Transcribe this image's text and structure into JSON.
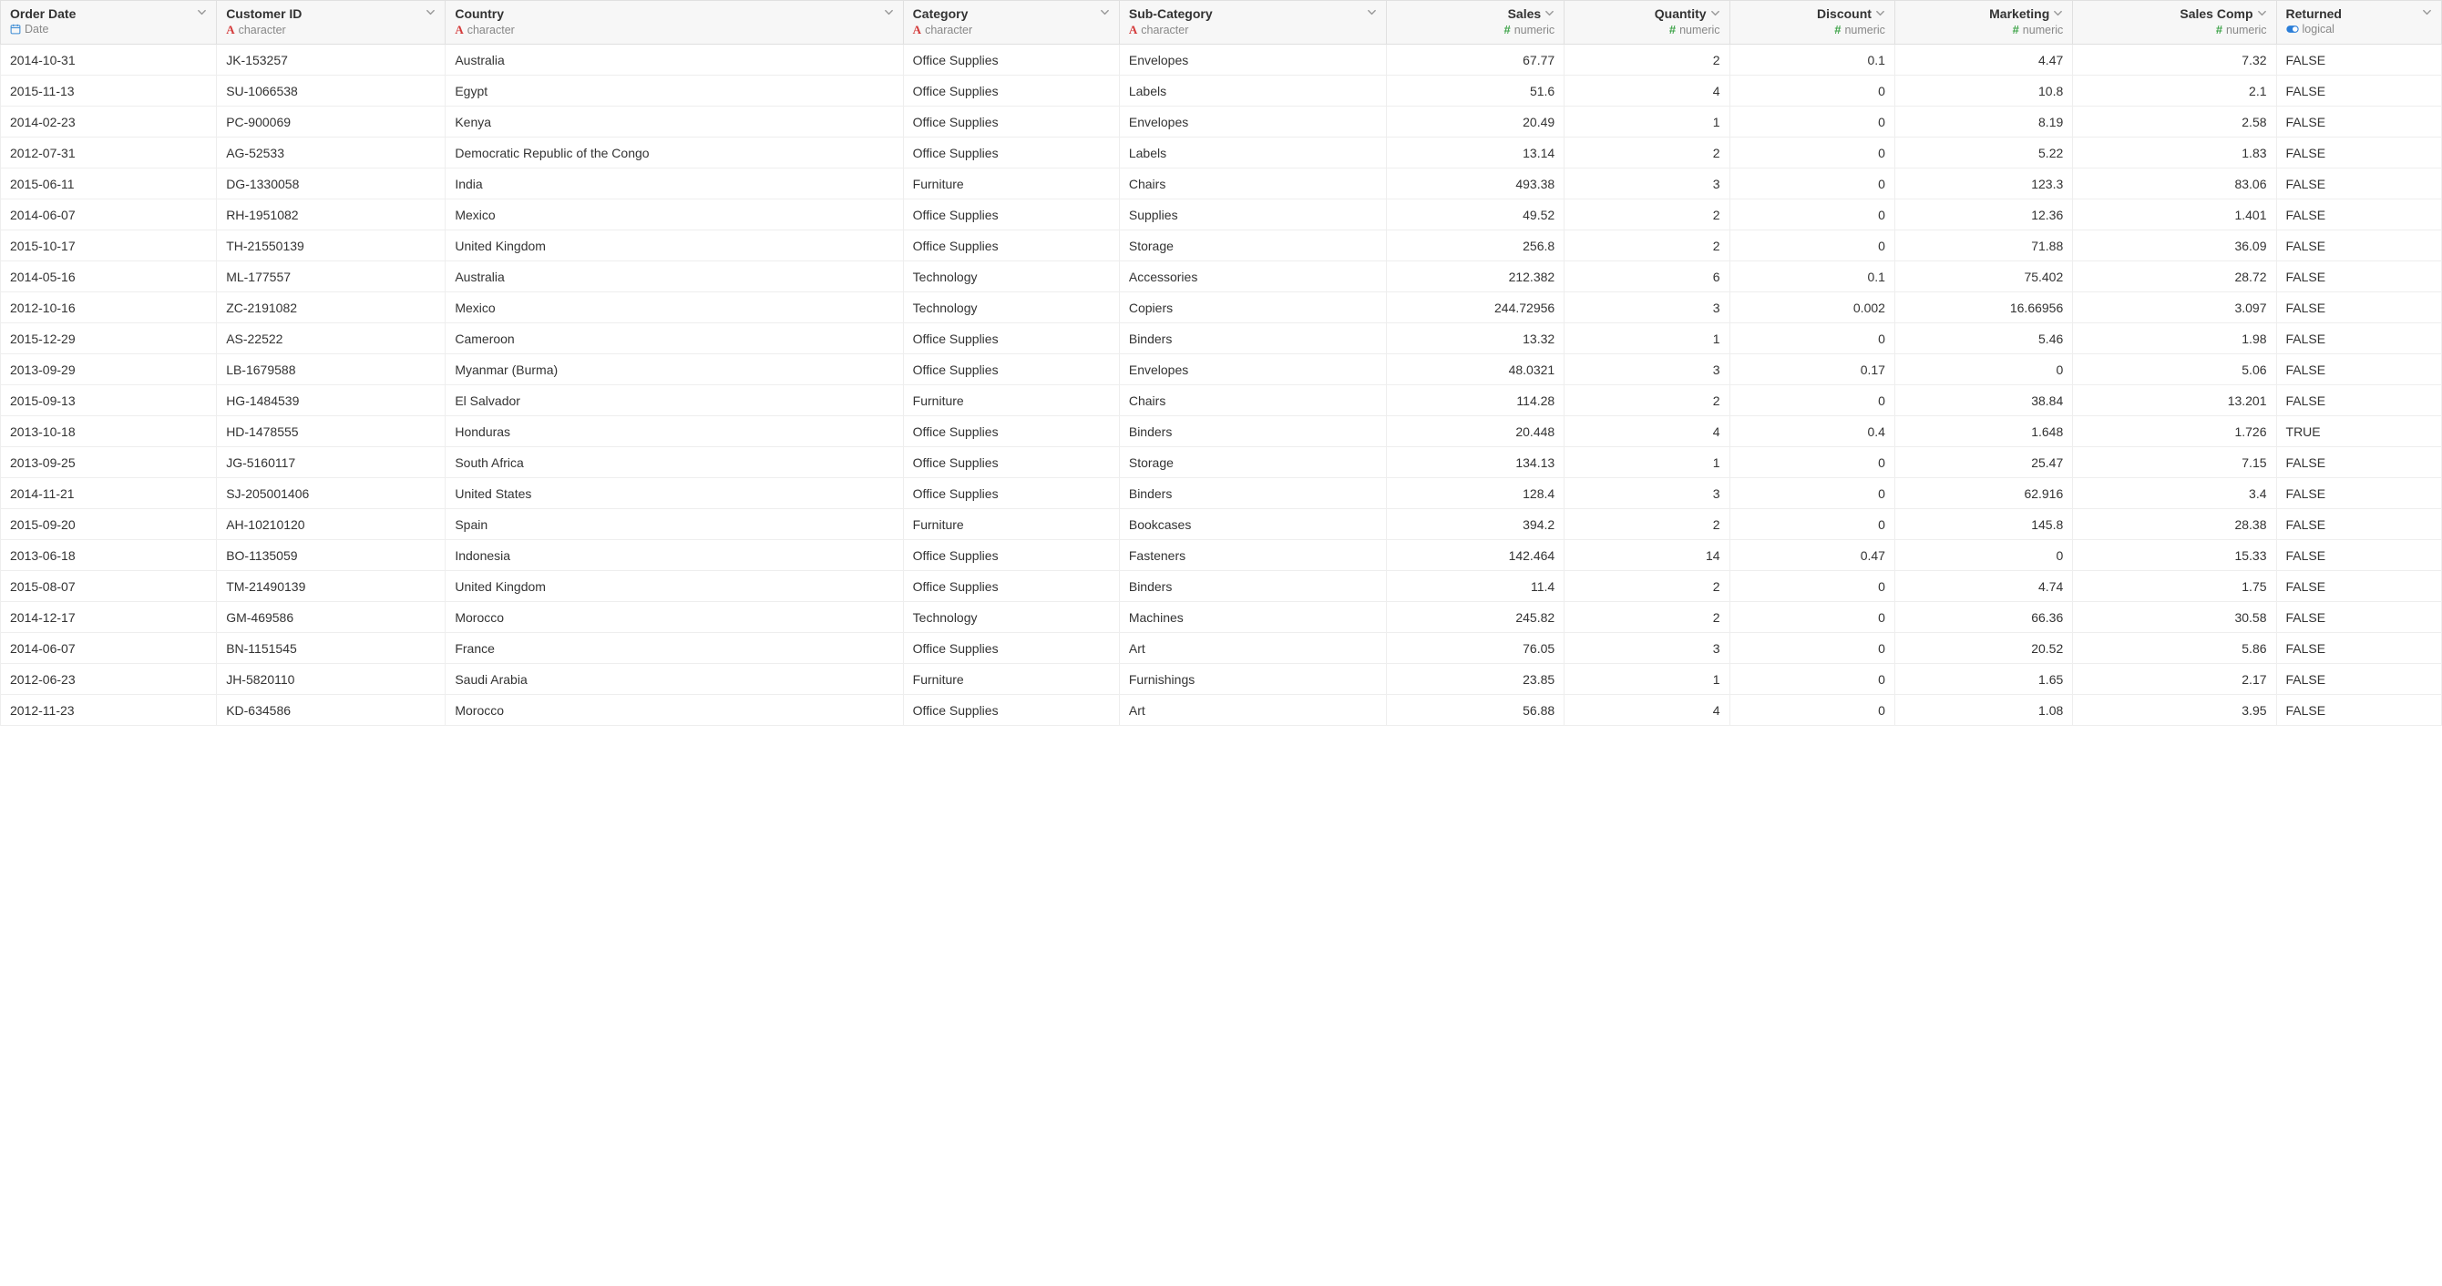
{
  "columns": [
    {
      "name": "Order Date",
      "type": "Date",
      "kind": "date",
      "align": "left",
      "width": "8.5%"
    },
    {
      "name": "Customer ID",
      "type": "character",
      "kind": "char",
      "align": "left",
      "width": "9%"
    },
    {
      "name": "Country",
      "type": "character",
      "kind": "char",
      "align": "left",
      "width": "18%"
    },
    {
      "name": "Category",
      "type": "character",
      "kind": "char",
      "align": "left",
      "width": "8.5%"
    },
    {
      "name": "Sub-Category",
      "type": "character",
      "kind": "char",
      "align": "left",
      "width": "10.5%"
    },
    {
      "name": "Sales",
      "type": "numeric",
      "kind": "numeric",
      "align": "right",
      "width": "7%"
    },
    {
      "name": "Quantity",
      "type": "numeric",
      "kind": "numeric",
      "align": "right",
      "width": "6.5%"
    },
    {
      "name": "Discount",
      "type": "numeric",
      "kind": "numeric",
      "align": "right",
      "width": "6.5%"
    },
    {
      "name": "Marketing",
      "type": "numeric",
      "kind": "numeric",
      "align": "right",
      "width": "7%"
    },
    {
      "name": "Sales Comp",
      "type": "numeric",
      "kind": "numeric",
      "align": "right",
      "width": "8%"
    },
    {
      "name": "Returned",
      "type": "logical",
      "kind": "logical",
      "align": "left",
      "width": "6.5%"
    }
  ],
  "rows": [
    [
      "2014-10-31",
      "JK-153257",
      "Australia",
      "Office Supplies",
      "Envelopes",
      "67.77",
      "2",
      "0.1",
      "4.47",
      "7.32",
      "FALSE"
    ],
    [
      "2015-11-13",
      "SU-1066538",
      "Egypt",
      "Office Supplies",
      "Labels",
      "51.6",
      "4",
      "0",
      "10.8",
      "2.1",
      "FALSE"
    ],
    [
      "2014-02-23",
      "PC-900069",
      "Kenya",
      "Office Supplies",
      "Envelopes",
      "20.49",
      "1",
      "0",
      "8.19",
      "2.58",
      "FALSE"
    ],
    [
      "2012-07-31",
      "AG-52533",
      "Democratic Republic of the Congo",
      "Office Supplies",
      "Labels",
      "13.14",
      "2",
      "0",
      "5.22",
      "1.83",
      "FALSE"
    ],
    [
      "2015-06-11",
      "DG-1330058",
      "India",
      "Furniture",
      "Chairs",
      "493.38",
      "3",
      "0",
      "123.3",
      "83.06",
      "FALSE"
    ],
    [
      "2014-06-07",
      "RH-1951082",
      "Mexico",
      "Office Supplies",
      "Supplies",
      "49.52",
      "2",
      "0",
      "12.36",
      "1.401",
      "FALSE"
    ],
    [
      "2015-10-17",
      "TH-21550139",
      "United Kingdom",
      "Office Supplies",
      "Storage",
      "256.8",
      "2",
      "0",
      "71.88",
      "36.09",
      "FALSE"
    ],
    [
      "2014-05-16",
      "ML-177557",
      "Australia",
      "Technology",
      "Accessories",
      "212.382",
      "6",
      "0.1",
      "75.402",
      "28.72",
      "FALSE"
    ],
    [
      "2012-10-16",
      "ZC-2191082",
      "Mexico",
      "Technology",
      "Copiers",
      "244.72956",
      "3",
      "0.002",
      "16.66956",
      "3.097",
      "FALSE"
    ],
    [
      "2015-12-29",
      "AS-22522",
      "Cameroon",
      "Office Supplies",
      "Binders",
      "13.32",
      "1",
      "0",
      "5.46",
      "1.98",
      "FALSE"
    ],
    [
      "2013-09-29",
      "LB-1679588",
      "Myanmar (Burma)",
      "Office Supplies",
      "Envelopes",
      "48.0321",
      "3",
      "0.17",
      "0",
      "5.06",
      "FALSE"
    ],
    [
      "2015-09-13",
      "HG-1484539",
      "El Salvador",
      "Furniture",
      "Chairs",
      "114.28",
      "2",
      "0",
      "38.84",
      "13.201",
      "FALSE"
    ],
    [
      "2013-10-18",
      "HD-1478555",
      "Honduras",
      "Office Supplies",
      "Binders",
      "20.448",
      "4",
      "0.4",
      "1.648",
      "1.726",
      "TRUE"
    ],
    [
      "2013-09-25",
      "JG-5160117",
      "South Africa",
      "Office Supplies",
      "Storage",
      "134.13",
      "1",
      "0",
      "25.47",
      "7.15",
      "FALSE"
    ],
    [
      "2014-11-21",
      "SJ-205001406",
      "United States",
      "Office Supplies",
      "Binders",
      "128.4",
      "3",
      "0",
      "62.916",
      "3.4",
      "FALSE"
    ],
    [
      "2015-09-20",
      "AH-10210120",
      "Spain",
      "Furniture",
      "Bookcases",
      "394.2",
      "2",
      "0",
      "145.8",
      "28.38",
      "FALSE"
    ],
    [
      "2013-06-18",
      "BO-1135059",
      "Indonesia",
      "Office Supplies",
      "Fasteners",
      "142.464",
      "14",
      "0.47",
      "0",
      "15.33",
      "FALSE"
    ],
    [
      "2015-08-07",
      "TM-21490139",
      "United Kingdom",
      "Office Supplies",
      "Binders",
      "11.4",
      "2",
      "0",
      "4.74",
      "1.75",
      "FALSE"
    ],
    [
      "2014-12-17",
      "GM-469586",
      "Morocco",
      "Technology",
      "Machines",
      "245.82",
      "2",
      "0",
      "66.36",
      "30.58",
      "FALSE"
    ],
    [
      "2014-06-07",
      "BN-1151545",
      "France",
      "Office Supplies",
      "Art",
      "76.05",
      "3",
      "0",
      "20.52",
      "5.86",
      "FALSE"
    ],
    [
      "2012-06-23",
      "JH-5820110",
      "Saudi Arabia",
      "Furniture",
      "Furnishings",
      "23.85",
      "1",
      "0",
      "1.65",
      "2.17",
      "FALSE"
    ],
    [
      "2012-11-23",
      "KD-634586",
      "Morocco",
      "Office Supplies",
      "Art",
      "56.88",
      "4",
      "0",
      "1.08",
      "3.95",
      "FALSE"
    ]
  ],
  "type_icons": {
    "date": "📅",
    "char": "A",
    "numeric": "#",
    "logical": "⏺"
  }
}
